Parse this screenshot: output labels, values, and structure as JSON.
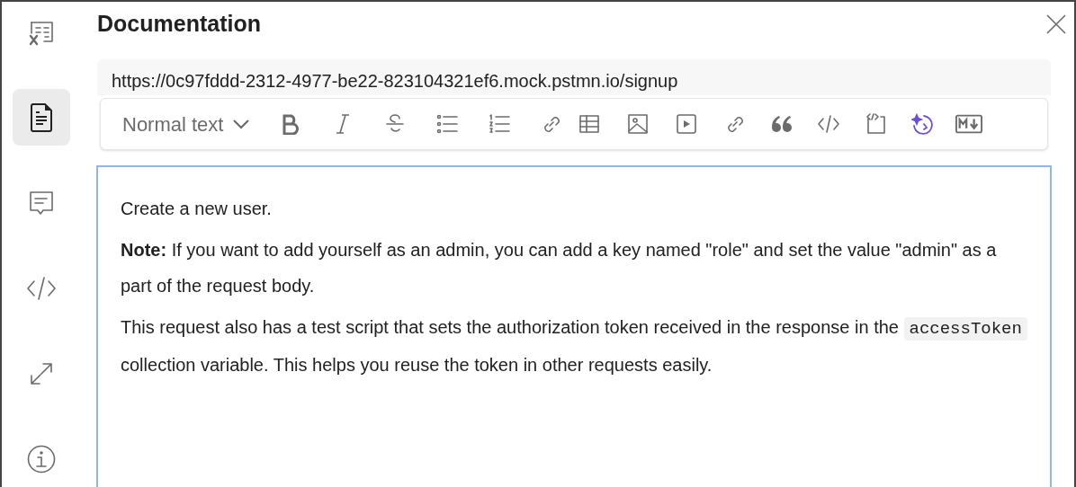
{
  "sidebar": {
    "items": [
      {
        "kind": "variables",
        "selected": false
      },
      {
        "kind": "documentation",
        "selected": true
      },
      {
        "kind": "comments",
        "selected": false
      },
      {
        "kind": "code",
        "selected": false
      },
      {
        "kind": "related",
        "selected": false
      },
      {
        "kind": "info",
        "selected": false
      }
    ]
  },
  "panel": {
    "title": "Documentation",
    "url": "https://0c97fddd-2312-4977-be22-823104321ef6.mock.pstmn.io/signup"
  },
  "toolbar": {
    "text_style": "Normal text"
  },
  "editor": {
    "paragraphs": [
      [
        {
          "kind": "text",
          "text": "Create a new user."
        }
      ],
      [
        {
          "kind": "text",
          "text": "**Note:** If you want to add yourself as an admin, you can add a key named \"role\" and set the value \"admin\" as a part of the request body."
        }
      ],
      [
        {
          "kind": "text",
          "text": "This request also has a test script that sets the authorization token received in the response in the "
        },
        {
          "kind": "code",
          "text": "accessToken"
        },
        {
          "kind": "text",
          "text": " collection variable. This helps you reuse the token in other requests easily."
        }
      ]
    ]
  }
}
